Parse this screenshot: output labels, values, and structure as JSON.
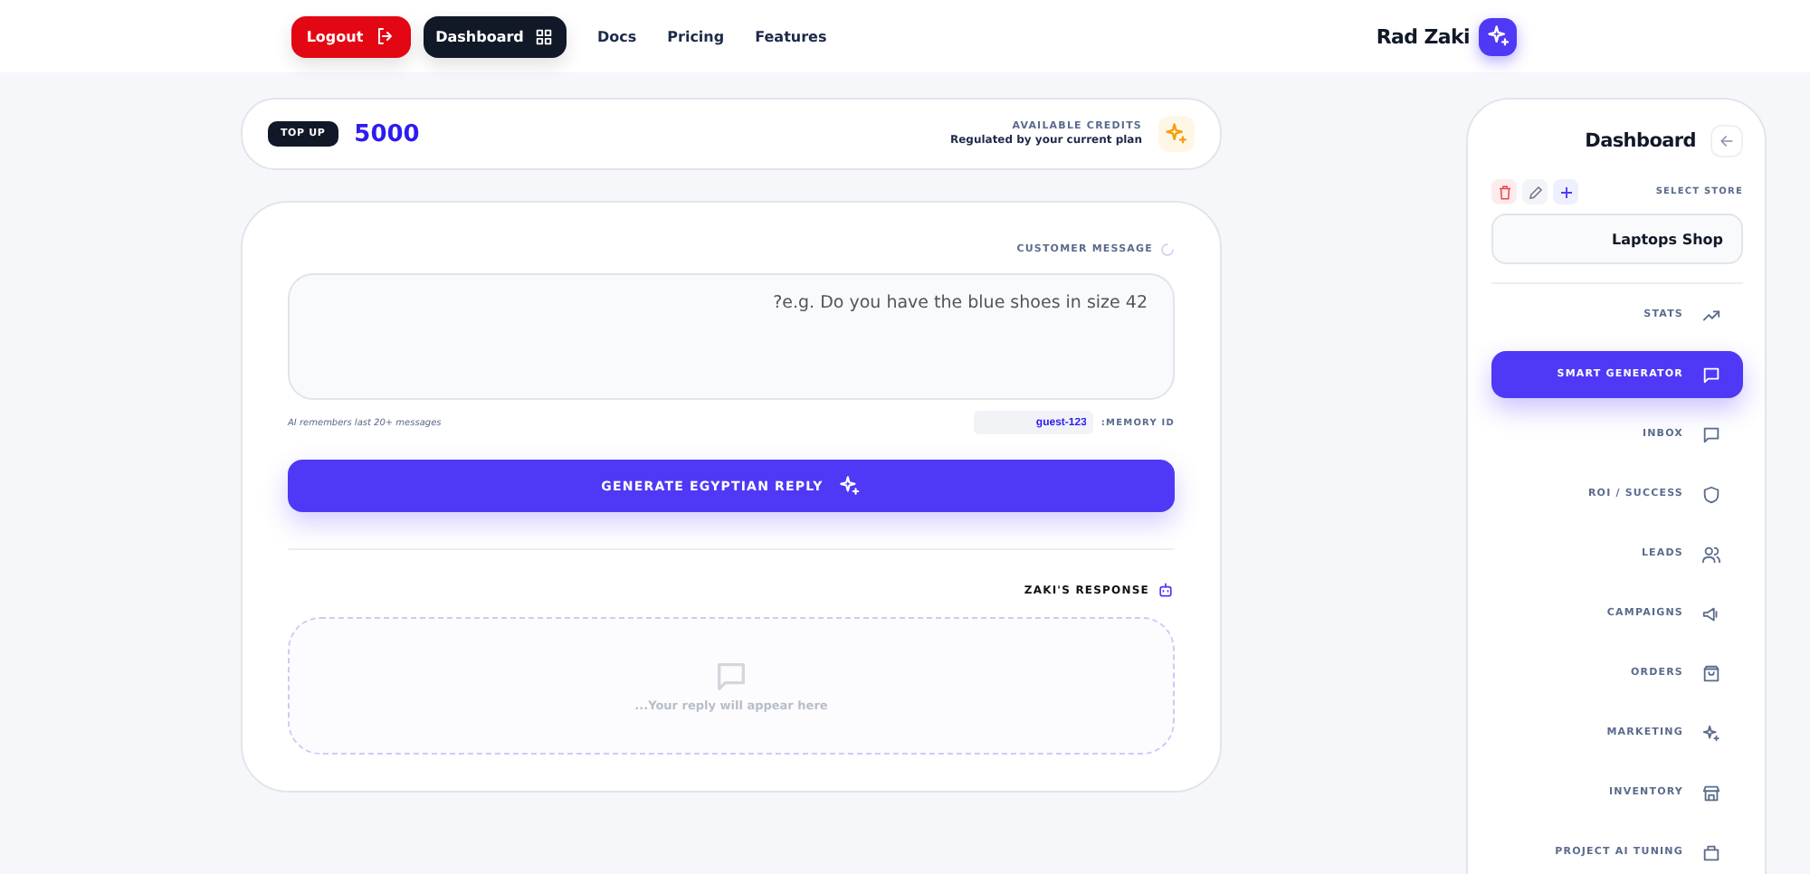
{
  "header": {
    "logout": "Logout",
    "dashboard": "Dashboard",
    "links": [
      "Docs",
      "Pricing",
      "Features"
    ],
    "user": "Rad Zaki"
  },
  "credits": {
    "top_up": "TOP UP",
    "amount": "5000",
    "label": "AVAILABLE CREDITS",
    "note": "Regulated by your current plan"
  },
  "composer": {
    "label": "CUSTOMER MESSAGE",
    "message": {
      "placeholder": "?e.g. Do you have the blue shoes in size 42"
    },
    "memory_note": "AI remembers last 20+ messages",
    "memory_id": {
      "value": "guest-123",
      "label": ":MEMORY ID"
    },
    "generate": "GENERATE EGYPTIAN REPLY",
    "response_label": "ZAKI'S RESPONSE",
    "response_placeholder": "...Your reply will appear here"
  },
  "sidebar": {
    "title": "Dashboard",
    "select_label": "SELECT STORE",
    "store": "Laptops Shop",
    "items": [
      {
        "label": "STATS",
        "kind": "stats",
        "selected": false
      },
      {
        "label": "SMART GENERATOR",
        "kind": "chat",
        "selected": true
      },
      {
        "label": "INBOX",
        "kind": "inbox",
        "selected": false
      },
      {
        "label": "ROI / SUCCESS",
        "kind": "shield",
        "selected": false
      },
      {
        "label": "LEADS",
        "kind": "users",
        "selected": false
      },
      {
        "label": "CAMPAIGNS",
        "kind": "megaphone",
        "selected": false
      },
      {
        "label": "ORDERS",
        "kind": "bag",
        "selected": false
      },
      {
        "label": "MARKETING",
        "kind": "sparkle",
        "selected": false
      },
      {
        "label": "INVENTORY",
        "kind": "store",
        "selected": false
      },
      {
        "label": "PROJECT AI TUNING",
        "kind": "box",
        "selected": false
      }
    ]
  }
}
